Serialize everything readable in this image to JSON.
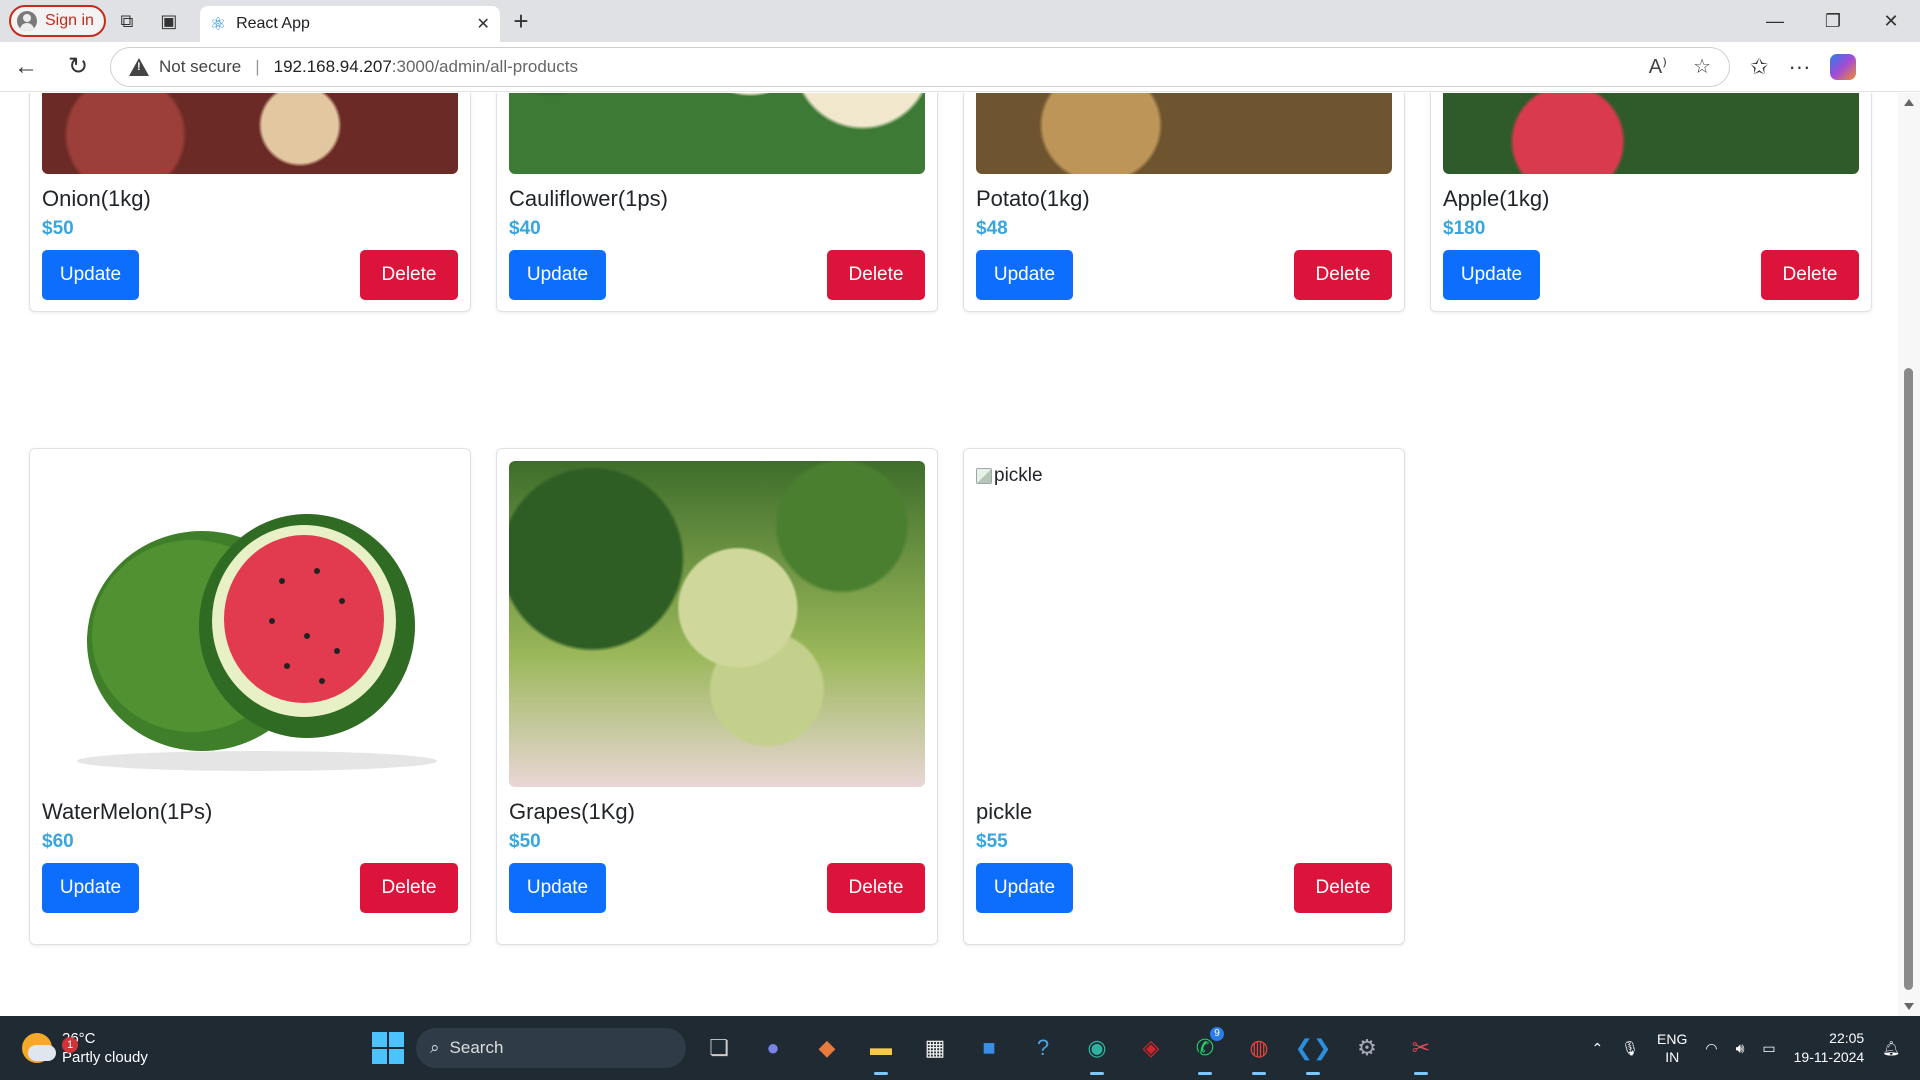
{
  "browser": {
    "signin_label": "Sign in",
    "tab_title": "React App",
    "url_security": "Not secure",
    "url_host": "192.168.94.207",
    "url_rest": ":3000/admin/all-products"
  },
  "products": [
    {
      "name": "Onion(1kg)",
      "price": "$50",
      "image": "onion"
    },
    {
      "name": "Cauliflower(1ps)",
      "price": "$40",
      "image": "cauliflower"
    },
    {
      "name": "Potato(1kg)",
      "price": "$48",
      "image": "potato"
    },
    {
      "name": "Apple(1kg)",
      "price": "$180",
      "image": "apple"
    },
    {
      "name": "WaterMelon(1Ps)",
      "price": "$60",
      "image": "watermelon"
    },
    {
      "name": "Grapes(1Kg)",
      "price": "$50",
      "image": "grapes"
    },
    {
      "name": "pickle",
      "price": "$55",
      "image": "broken",
      "image_alt": "pickle"
    }
  ],
  "buttons": {
    "update_label": "Update",
    "delete_label": "Delete"
  },
  "taskbar": {
    "weather_temp": "26°C",
    "weather_desc": "Partly cloudy",
    "weather_badge": "1",
    "search_placeholder": "Search",
    "whatsapp_badge": "9",
    "lang_line1": "ENG",
    "lang_line2": "IN",
    "time": "22:05",
    "date": "19-11-2024"
  },
  "colors": {
    "update_button": "#0d6efd",
    "delete_button": "#dc143c",
    "price_text": "#37a6e0"
  }
}
